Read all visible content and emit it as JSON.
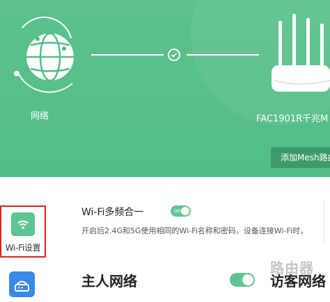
{
  "colors": {
    "header_green": "#55be89",
    "accent_green": "#5ec492",
    "button_green": "#3e9a6c",
    "highlight_red": "#e02020",
    "router_icon_blue": "#3a88e8"
  },
  "topology": {
    "network_label": "网络",
    "router_name": "FAC1901R千兆M",
    "add_mesh_button": "添加Mesh路由",
    "connection_status_icon": "check-circle-icon"
  },
  "sidebar": {
    "items": [
      {
        "label": "Wi-Fi设置",
        "icon": "wifi-icon",
        "selected": true
      },
      {
        "label": "",
        "icon": "router-icon",
        "selected": false
      }
    ]
  },
  "main": {
    "multiband": {
      "title": "Wi-Fi多频合一",
      "toggle_text": "on",
      "description": "开启后2.4G和5G使用相同的Wi-Fi名称和密码，设备连接Wi-Fi时，"
    },
    "host_network_title": "主人网络",
    "guest_network_title": "访客网络"
  },
  "watermark": "路由器"
}
